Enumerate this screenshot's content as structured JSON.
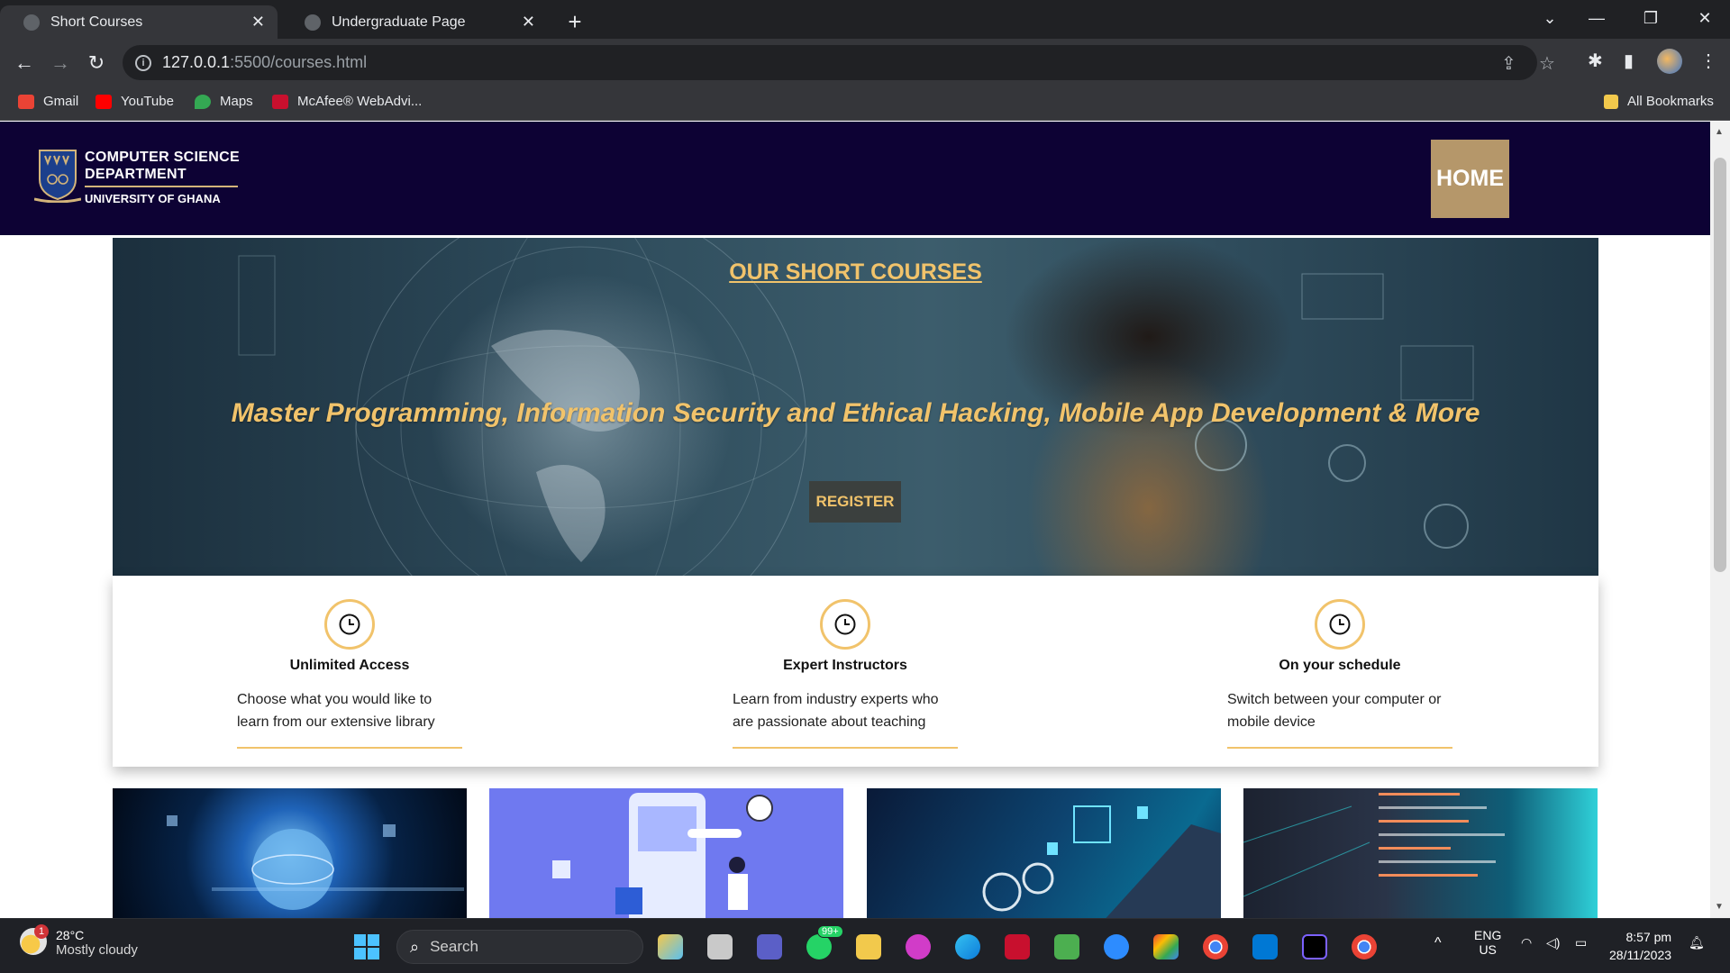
{
  "browser": {
    "tabs": [
      {
        "title": "Short Courses",
        "active": true
      },
      {
        "title": "Undergraduate Page",
        "active": false
      }
    ],
    "url_host": "127.0.0.1",
    "url_rest": ":5500/courses.html",
    "bookmarks": [
      {
        "label": "Gmail",
        "color": "#ea4335"
      },
      {
        "label": "YouTube",
        "color": "#ff0000"
      },
      {
        "label": "Maps",
        "color": "#34a853"
      },
      {
        "label": "McAfee® WebAdvi...",
        "color": "#c8102e"
      }
    ],
    "all_bookmarks": "All Bookmarks"
  },
  "site": {
    "brand_line1": "COMPUTER SCIENCE",
    "brand_line2": "DEPARTMENT",
    "brand_line3": "UNIVERSITY OF GHANA",
    "home_label": "HOME",
    "header_color": "#0d0234",
    "accent": "#f1c36b"
  },
  "hero": {
    "title": "OUR SHORT COURSES",
    "tagline": "Master Programming, Information Security and Ethical Hacking, Mobile App Development & More",
    "register_label": "REGISTER"
  },
  "features": [
    {
      "icon": "clock-icon",
      "title": "Unlimited Access",
      "text": "Choose what you would like to learn from our extensive library"
    },
    {
      "icon": "clock-icon",
      "title": "Expert Instructors",
      "text": "Learn from industry experts who are passionate about teaching"
    },
    {
      "icon": "clock-icon",
      "title": "On your schedule",
      "text": "Switch between your computer or mobile device"
    }
  ],
  "taskbar": {
    "weather_temp": "28°C",
    "weather_desc": "Mostly cloudy",
    "weather_badge": "1",
    "search_placeholder": "Search",
    "whatsapp_badge": "99+",
    "lang_line1": "ENG",
    "lang_line2": "US",
    "time": "8:57 pm",
    "date": "28/11/2023"
  }
}
